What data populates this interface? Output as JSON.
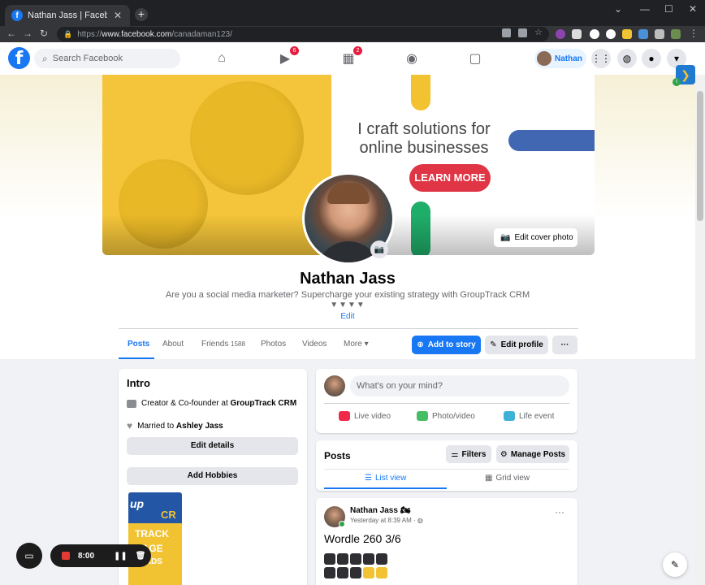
{
  "browser": {
    "tab_title": "Nathan Jass | Facebook",
    "url_prefix": "https://",
    "url_domain": "www.facebook.com",
    "url_path": "/canadaman123/",
    "new_tab_symbol": "+",
    "close_symbol": "✕"
  },
  "fb_header": {
    "logo": "f",
    "search_placeholder": "Search Facebook",
    "watch_badge": "6",
    "marketplace_badge": "2",
    "profile_name": "Nathan"
  },
  "cover": {
    "tagline": "I craft solutions for online businesses",
    "cta": "LEARN MORE",
    "edit_cover_label": "Edit cover photo"
  },
  "profile": {
    "name": "Nathan Jass",
    "bio": "Are you a social media marketer? Supercharge your existing strategy with GroupTrack CRM",
    "bio_triangles": "▼▼▼▼",
    "bio_edit": "Edit"
  },
  "tabs": {
    "posts": "Posts",
    "about": "About",
    "friends": "Friends",
    "friends_count": "1588",
    "photos": "Photos",
    "videos": "Videos",
    "more": "More"
  },
  "actions": {
    "add_story": "Add to story",
    "edit_profile": "Edit profile",
    "more_dots": "···"
  },
  "intro": {
    "title": "Intro",
    "work_prefix": "Creator & Co-founder at ",
    "work_company": "GroupTrack CRM",
    "relationship_prefix": "Married to ",
    "relationship_name": "Ashley Jass",
    "edit_details": "Edit details",
    "add_hobbies": "Add Hobbies",
    "photo_text_1": "up",
    "photo_text_2": "CR",
    "photo_text_3": "TRACK",
    "photo_text_4": "NAGE",
    "photo_text_5": "LEADS"
  },
  "composer": {
    "placeholder": "What's on your mind?",
    "live_video": "Live video",
    "photo_video": "Photo/video",
    "life_event": "Life event"
  },
  "posts_section": {
    "title": "Posts",
    "filters": "Filters",
    "manage_posts": "Manage Posts",
    "list_view": "List view",
    "grid_view": "Grid view"
  },
  "post": {
    "author": "Nathan Jass",
    "time": "Yesterday at 8:39 AM · ",
    "text": "Wordle 260 3/6",
    "more": "···"
  },
  "recorder": {
    "time": "8:00"
  },
  "icons": {
    "home": "home-icon",
    "watch": "video-icon",
    "marketplace": "store-icon",
    "groups": "groups-icon",
    "gaming": "gaming-icon",
    "menu": "grid-menu-icon",
    "messenger": "messenger-icon",
    "notifications": "bell-icon",
    "account": "chevron-down-icon"
  },
  "colors": {
    "fb_blue": "#1877f2",
    "badge_red": "#e41e3f",
    "cta_red": "#e03545",
    "cover_yellow": "#f4c53a"
  }
}
